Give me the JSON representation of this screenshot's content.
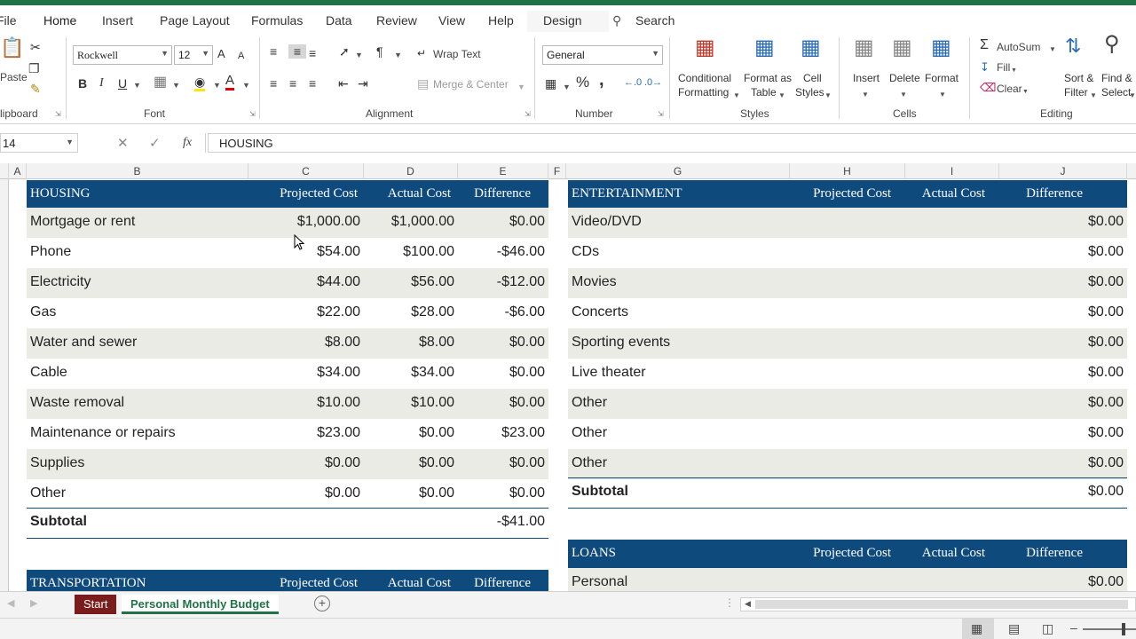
{
  "ribbon_tabs": [
    "File",
    "Home",
    "Insert",
    "Page Layout",
    "Formulas",
    "Data",
    "Review",
    "View",
    "Help",
    "Design"
  ],
  "search_label": "Search",
  "clipboard": {
    "paste_label": "Paste",
    "group_label": "lipboard"
  },
  "font": {
    "name": "Rockwell",
    "size": "12",
    "group_label": "Font",
    "bold": "B",
    "italic": "I",
    "underline": "U",
    "grow": "A",
    "shrink": "A"
  },
  "alignment": {
    "wrap_text": "Wrap Text",
    "merge_center": "Merge & Center",
    "group_label": "Alignment"
  },
  "number": {
    "format": "General",
    "percent": "%",
    "comma": ",",
    "group_label": "Number"
  },
  "styles": {
    "conditional_1": "Conditional",
    "conditional_2": "Formatting",
    "format_table_1": "Format as",
    "format_table_2": "Table",
    "cell_styles_1": "Cell",
    "cell_styles_2": "Styles",
    "group_label": "Styles"
  },
  "cells": {
    "insert": "Insert",
    "delete": "Delete",
    "format": "Format",
    "group_label": "Cells"
  },
  "editing": {
    "autosum": "AutoSum",
    "fill": "Fill",
    "clear": "Clear",
    "sort_1": "Sort &",
    "sort_2": "Filter",
    "find_1": "Find &",
    "find_2": "Select",
    "group_label": "Editing"
  },
  "formula_bar": {
    "name_box": "14",
    "fx": "fx",
    "formula": "HOUSING"
  },
  "columns": [
    "A",
    "B",
    "C",
    "D",
    "E",
    "F",
    "G",
    "H",
    "I",
    "J"
  ],
  "housing": {
    "title": "HOUSING",
    "headers": [
      "Projected Cost",
      "Actual Cost",
      "Difference"
    ],
    "rows": [
      {
        "item": "Mortgage or rent",
        "projected": "$1,000.00",
        "actual": "$1,000.00",
        "diff": "$0.00"
      },
      {
        "item": "Phone",
        "projected": "$54.00",
        "actual": "$100.00",
        "diff": "-$46.00"
      },
      {
        "item": "Electricity",
        "projected": "$44.00",
        "actual": "$56.00",
        "diff": "-$12.00"
      },
      {
        "item": "Gas",
        "projected": "$22.00",
        "actual": "$28.00",
        "diff": "-$6.00"
      },
      {
        "item": "Water and sewer",
        "projected": "$8.00",
        "actual": "$8.00",
        "diff": "$0.00"
      },
      {
        "item": "Cable",
        "projected": "$34.00",
        "actual": "$34.00",
        "diff": "$0.00"
      },
      {
        "item": "Waste removal",
        "projected": "$10.00",
        "actual": "$10.00",
        "diff": "$0.00"
      },
      {
        "item": "Maintenance or repairs",
        "projected": "$23.00",
        "actual": "$0.00",
        "diff": "$23.00"
      },
      {
        "item": "Supplies",
        "projected": "$0.00",
        "actual": "$0.00",
        "diff": "$0.00"
      },
      {
        "item": "Other",
        "projected": "$0.00",
        "actual": "$0.00",
        "diff": "$0.00"
      }
    ],
    "subtotal_label": "Subtotal",
    "subtotal_value": "-$41.00"
  },
  "transportation": {
    "title": "TRANSPORTATION",
    "headers": [
      "Projected Cost",
      "Actual Cost",
      "Difference"
    ]
  },
  "entertainment": {
    "title": "ENTERTAINMENT",
    "headers": [
      "Projected Cost",
      "Actual Cost",
      "Difference"
    ],
    "rows": [
      {
        "item": "Video/DVD",
        "diff": "$0.00"
      },
      {
        "item": "CDs",
        "diff": "$0.00"
      },
      {
        "item": "Movies",
        "diff": "$0.00"
      },
      {
        "item": "Concerts",
        "diff": "$0.00"
      },
      {
        "item": "Sporting events",
        "diff": "$0.00"
      },
      {
        "item": "Live theater",
        "diff": "$0.00"
      },
      {
        "item": "Other",
        "diff": "$0.00"
      },
      {
        "item": "Other",
        "diff": "$0.00"
      },
      {
        "item": "Other",
        "diff": "$0.00"
      }
    ],
    "subtotal_label": "Subtotal",
    "subtotal_value": "$0.00"
  },
  "loans": {
    "title": "LOANS",
    "headers": [
      "Projected Cost",
      "Actual Cost",
      "Difference"
    ],
    "rows": [
      {
        "item": "Personal",
        "diff": "$0.00"
      }
    ]
  },
  "sheet_tabs": [
    "Start",
    "Personal Monthly Budget"
  ],
  "colors": {
    "excel_green": "#217346",
    "header_blue": "#0f4a7c",
    "start_tab": "#7b1c1c",
    "band": "#ebebe6"
  }
}
